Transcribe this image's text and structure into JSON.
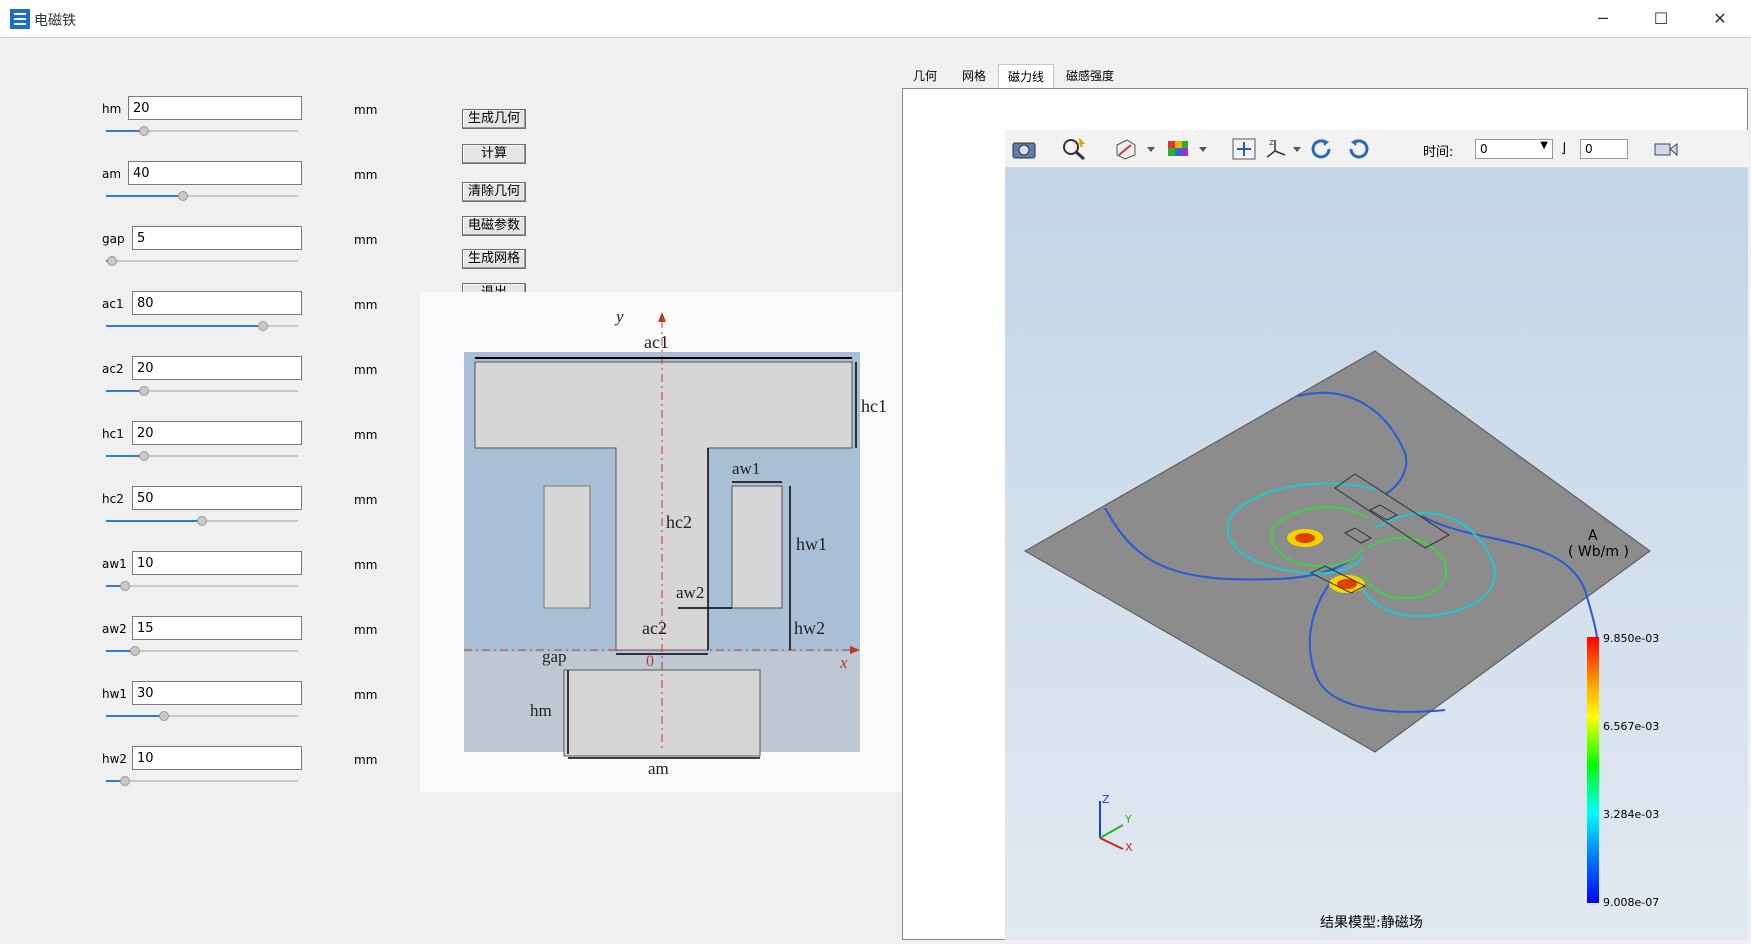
{
  "window": {
    "title": "电磁铁",
    "minimize": "─",
    "maximize": "☐",
    "close": "✕"
  },
  "params": [
    {
      "name": "hm",
      "value": "20",
      "unit": "mm",
      "slider": 0.2
    },
    {
      "name": "am",
      "value": "40",
      "unit": "mm",
      "slider": 0.4
    },
    {
      "name": "gap",
      "value": "5",
      "unit": "mm",
      "slider": 0.03
    },
    {
      "name": "ac1",
      "value": "80",
      "unit": "mm",
      "slider": 0.82
    },
    {
      "name": "ac2",
      "value": "20",
      "unit": "mm",
      "slider": 0.2
    },
    {
      "name": "hc1",
      "value": "20",
      "unit": "mm",
      "slider": 0.2
    },
    {
      "name": "hc2",
      "value": "50",
      "unit": "mm",
      "slider": 0.5
    },
    {
      "name": "aw1",
      "value": "10",
      "unit": "mm",
      "slider": 0.1
    },
    {
      "name": "aw2",
      "value": "15",
      "unit": "mm",
      "slider": 0.15
    },
    {
      "name": "hw1",
      "value": "30",
      "unit": "mm",
      "slider": 0.3
    },
    {
      "name": "hw2",
      "value": "10",
      "unit": "mm",
      "slider": 0.1
    }
  ],
  "buttons": {
    "gen_geometry": "生成几何",
    "compute": "计算",
    "clear_geometry": "清除几何",
    "em_params": "电磁参数",
    "gen_mesh": "生成网格",
    "exit": "退出"
  },
  "diagram": {
    "y_axis": "y",
    "x_axis": "x",
    "origin": "0",
    "labels": {
      "ac1": "ac1",
      "hc1": "hc1",
      "hc2": "hc2",
      "aw1": "aw1",
      "hw1": "hw1",
      "aw2": "aw2",
      "ac2": "ac2",
      "hw2": "hw2",
      "gap": "gap",
      "hm": "hm",
      "am": "am"
    }
  },
  "tabs": [
    "几何",
    "网格",
    "磁力线",
    "磁感强度"
  ],
  "active_tab": "磁力线",
  "toolbar": {
    "time_label": "时间:",
    "time_value": "0",
    "step_value": "0",
    "icons": [
      "camera-icon",
      "zoom-icon",
      "view-cube-icon",
      "color-map-icon",
      "fit-view-icon",
      "axes-icon",
      "rotate-cw-icon",
      "rotate-ccw-icon",
      "record-icon"
    ]
  },
  "legend": {
    "variable": "A",
    "unit": "( Wb/m )",
    "ticks": [
      "9.850e-03",
      "6.567e-03",
      "3.284e-03",
      "9.008e-07"
    ]
  },
  "triad": {
    "x": "X",
    "y": "Y",
    "z": "Z"
  },
  "status": "结果模型:静磁场",
  "colors": {
    "accent": "#2f7bd0",
    "plate": "#8c8c8c",
    "diagram_bg": "#a9bfd6"
  }
}
